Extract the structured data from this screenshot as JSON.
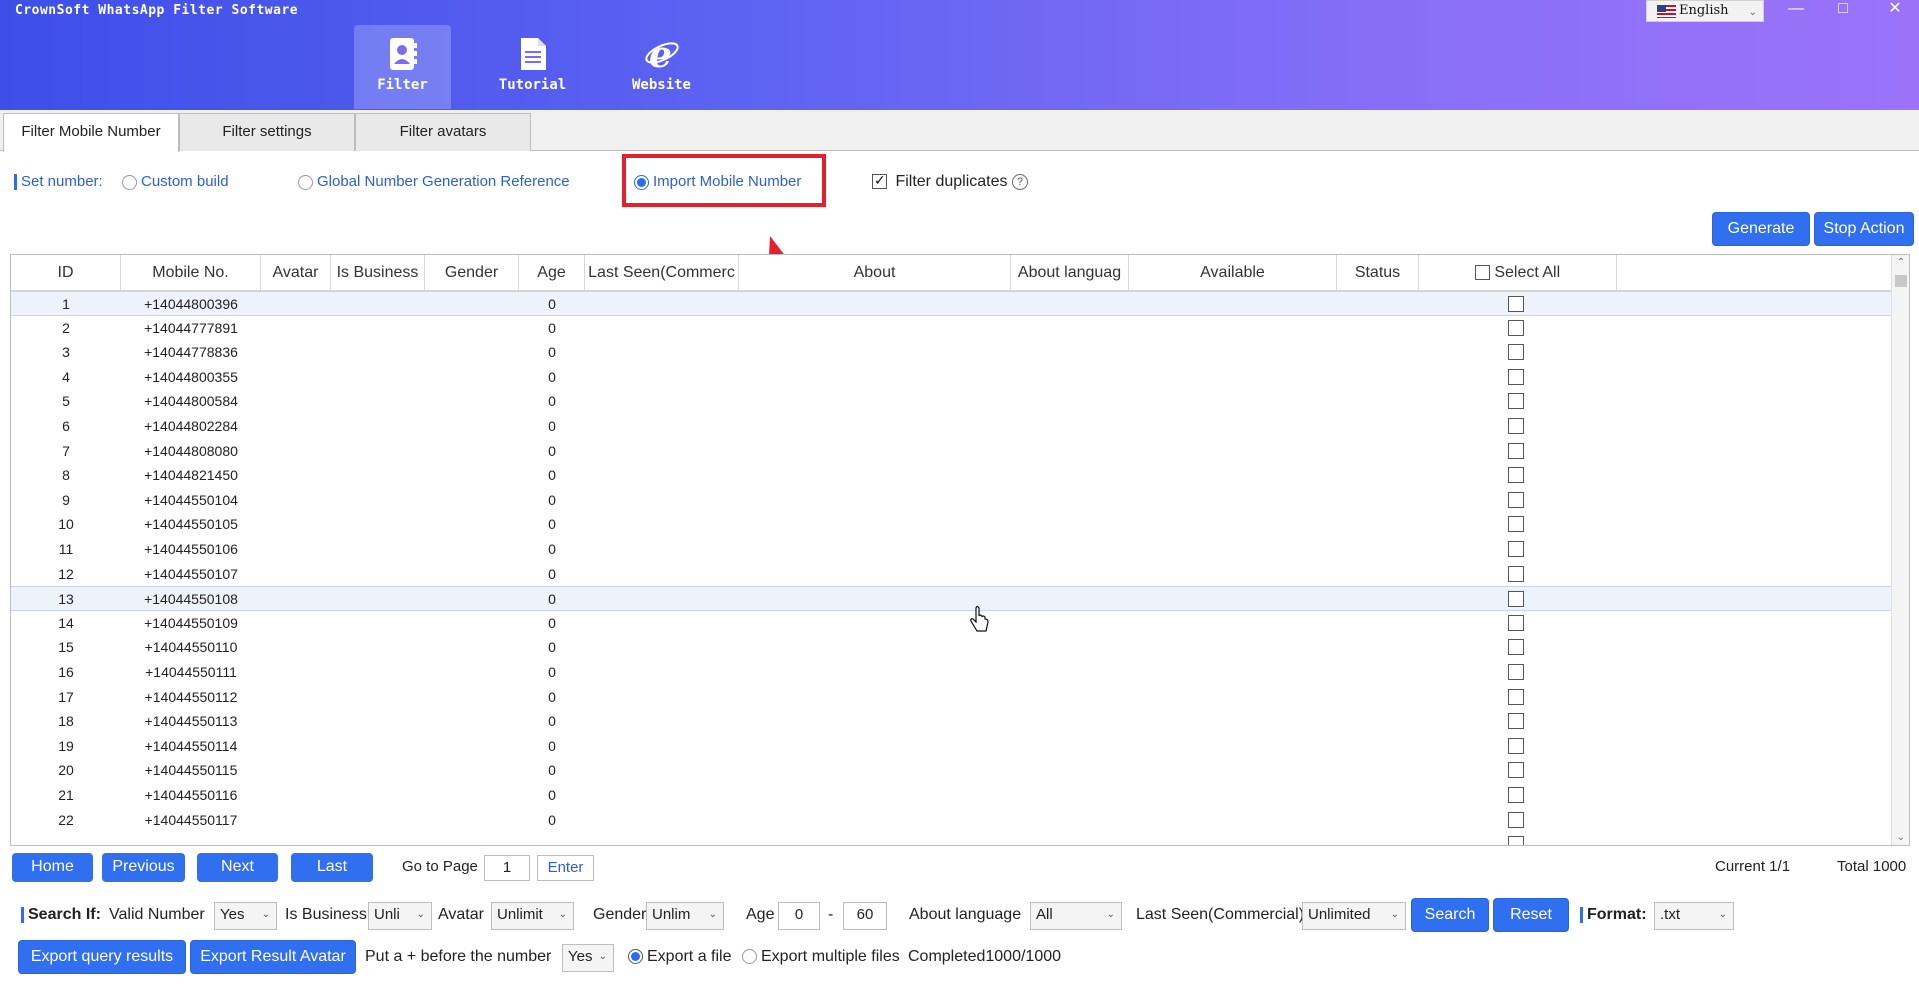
{
  "app": {
    "title": "CrownSoft WhatsApp Filter Software",
    "nav": [
      {
        "label": "Filter",
        "icon": "contact-card-icon"
      },
      {
        "label": "Tutorial",
        "icon": "document-icon"
      },
      {
        "label": "Website",
        "icon": "browser-e-icon"
      }
    ],
    "language": "English"
  },
  "tabs": [
    "Filter Mobile Number",
    "Filter settings",
    "Filter avatars"
  ],
  "settings": {
    "set_number_label": "Set number:",
    "options": [
      "Custom build",
      "Global Number Generation Reference",
      "Import Mobile Number"
    ],
    "selected_option": "Import Mobile Number",
    "filter_duplicates_label": "Filter duplicates",
    "filter_duplicates_checked": true
  },
  "actions": {
    "generate": "Generate",
    "stop": "Stop Action"
  },
  "table": {
    "columns": [
      "ID",
      "Mobile No.",
      "Avatar",
      "Is Business",
      "Gender",
      "Age",
      "Last Seen(Commerc",
      "About",
      "About languag",
      "Available",
      "Status"
    ],
    "select_all_label": "Select All",
    "rows": [
      {
        "id": "1",
        "mobile": "+14044800396",
        "age": "0"
      },
      {
        "id": "2",
        "mobile": "+14044777891",
        "age": "0"
      },
      {
        "id": "3",
        "mobile": "+14044778836",
        "age": "0"
      },
      {
        "id": "4",
        "mobile": "+14044800355",
        "age": "0"
      },
      {
        "id": "5",
        "mobile": "+14044800584",
        "age": "0"
      },
      {
        "id": "6",
        "mobile": "+14044802284",
        "age": "0"
      },
      {
        "id": "7",
        "mobile": "+14044808080",
        "age": "0"
      },
      {
        "id": "8",
        "mobile": "+14044821450",
        "age": "0"
      },
      {
        "id": "9",
        "mobile": "+14044550104",
        "age": "0"
      },
      {
        "id": "10",
        "mobile": "+14044550105",
        "age": "0"
      },
      {
        "id": "11",
        "mobile": "+14044550106",
        "age": "0"
      },
      {
        "id": "12",
        "mobile": "+14044550107",
        "age": "0"
      },
      {
        "id": "13",
        "mobile": "+14044550108",
        "age": "0"
      },
      {
        "id": "14",
        "mobile": "+14044550109",
        "age": "0"
      },
      {
        "id": "15",
        "mobile": "+14044550110",
        "age": "0"
      },
      {
        "id": "16",
        "mobile": "+14044550111",
        "age": "0"
      },
      {
        "id": "17",
        "mobile": "+14044550112",
        "age": "0"
      },
      {
        "id": "18",
        "mobile": "+14044550113",
        "age": "0"
      },
      {
        "id": "19",
        "mobile": "+14044550114",
        "age": "0"
      },
      {
        "id": "20",
        "mobile": "+14044550115",
        "age": "0"
      },
      {
        "id": "21",
        "mobile": "+14044550116",
        "age": "0"
      },
      {
        "id": "22",
        "mobile": "+14044550117",
        "age": "0"
      }
    ],
    "selected_row_ids": [
      "1",
      "13"
    ]
  },
  "pager": {
    "home": "Home",
    "previous": "Previous",
    "next": "Next",
    "last": "Last",
    "go_to_page_label": "Go to Page",
    "page_value": "1",
    "enter": "Enter",
    "current": "Current 1/1",
    "total": "Total 1000"
  },
  "search": {
    "label": "Search If:",
    "valid_number_label": "Valid Number",
    "valid_number_value": "Yes",
    "is_business_label": "Is Business",
    "is_business_value": "Unli",
    "avatar_label": "Avatar",
    "avatar_value": "Unlimit",
    "gender_label": "Gender",
    "gender_value": "Unlim",
    "age_label": "Age",
    "age_min": "0",
    "age_sep": "-",
    "age_max": "60",
    "about_language_label": "About language",
    "about_language_value": "All",
    "last_seen_label": "Last Seen(Commercial)",
    "last_seen_value": "Unlimited",
    "search_button": "Search",
    "reset_button": "Reset",
    "format_label": "Format:",
    "format_value": ".txt"
  },
  "export": {
    "query_results": "Export query results",
    "result_avatar": "Export Result Avatar",
    "plus_label": "Put a + before the number",
    "plus_value": "Yes",
    "export_file": "Export a file",
    "export_multiple": "Export multiple files",
    "completed": "Completed1000/1000"
  },
  "colors": {
    "accent": "#2f6ff0",
    "highlight_box": "#e4212b",
    "header_start": "#3d4fe8",
    "header_end": "#9a73f9"
  }
}
